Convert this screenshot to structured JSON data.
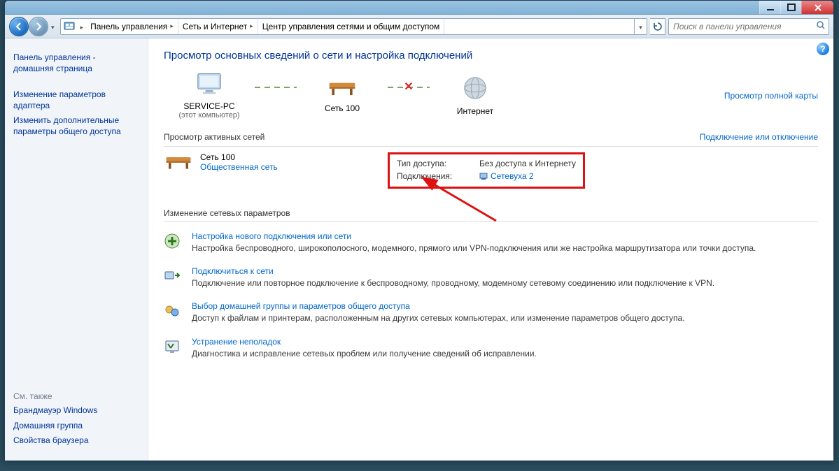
{
  "breadcrumb": {
    "items": [
      "Панель управления",
      "Сеть и Интернет",
      "Центр управления сетями и общим доступом"
    ]
  },
  "search": {
    "placeholder": "Поиск в панели управления"
  },
  "sidebar": {
    "home_line1": "Панель управления -",
    "home_line2": "домашняя страница",
    "links": [
      "Изменение параметров адаптера",
      "Изменить дополнительные параметры общего доступа"
    ],
    "seealso_label": "См. также",
    "seealso": [
      "Брандмауэр Windows",
      "Домашняя группа",
      "Свойства браузера"
    ]
  },
  "main": {
    "heading": "Просмотр основных сведений о сети и настройка подключений",
    "map": {
      "this_pc": "SERVICE-PC",
      "this_pc_sub": "(этот компьютер)",
      "network": "Сеть  100",
      "internet": "Интернет",
      "full_map_link": "Просмотр полной карты"
    },
    "active_nets": {
      "label": "Просмотр активных сетей",
      "toggle_link": "Подключение или отключение",
      "net_name": "Сеть  100",
      "net_type": "Общественная сеть",
      "access_label": "Тип доступа:",
      "access_value": "Без доступа к Интернету",
      "conn_label": "Подключения:",
      "conn_value": "Сетевуха 2"
    },
    "change_params": "Изменение сетевых параметров",
    "tasks": [
      {
        "title": "Настройка нового подключения или сети",
        "desc": "Настройка беспроводного, широкополосного, модемного, прямого или VPN-подключения или же настройка маршрутизатора или точки доступа."
      },
      {
        "title": "Подключиться к сети",
        "desc": "Подключение или повторное подключение к беспроводному, проводному, модемному сетевому соединению или подключение к VPN."
      },
      {
        "title": "Выбор домашней группы и параметров общего доступа",
        "desc": "Доступ к файлам и принтерам, расположенным на других сетевых компьютерах, или изменение параметров общего доступа."
      },
      {
        "title": "Устранение неполадок",
        "desc": "Диагностика и исправление сетевых проблем или получение сведений об исправлении."
      }
    ]
  }
}
